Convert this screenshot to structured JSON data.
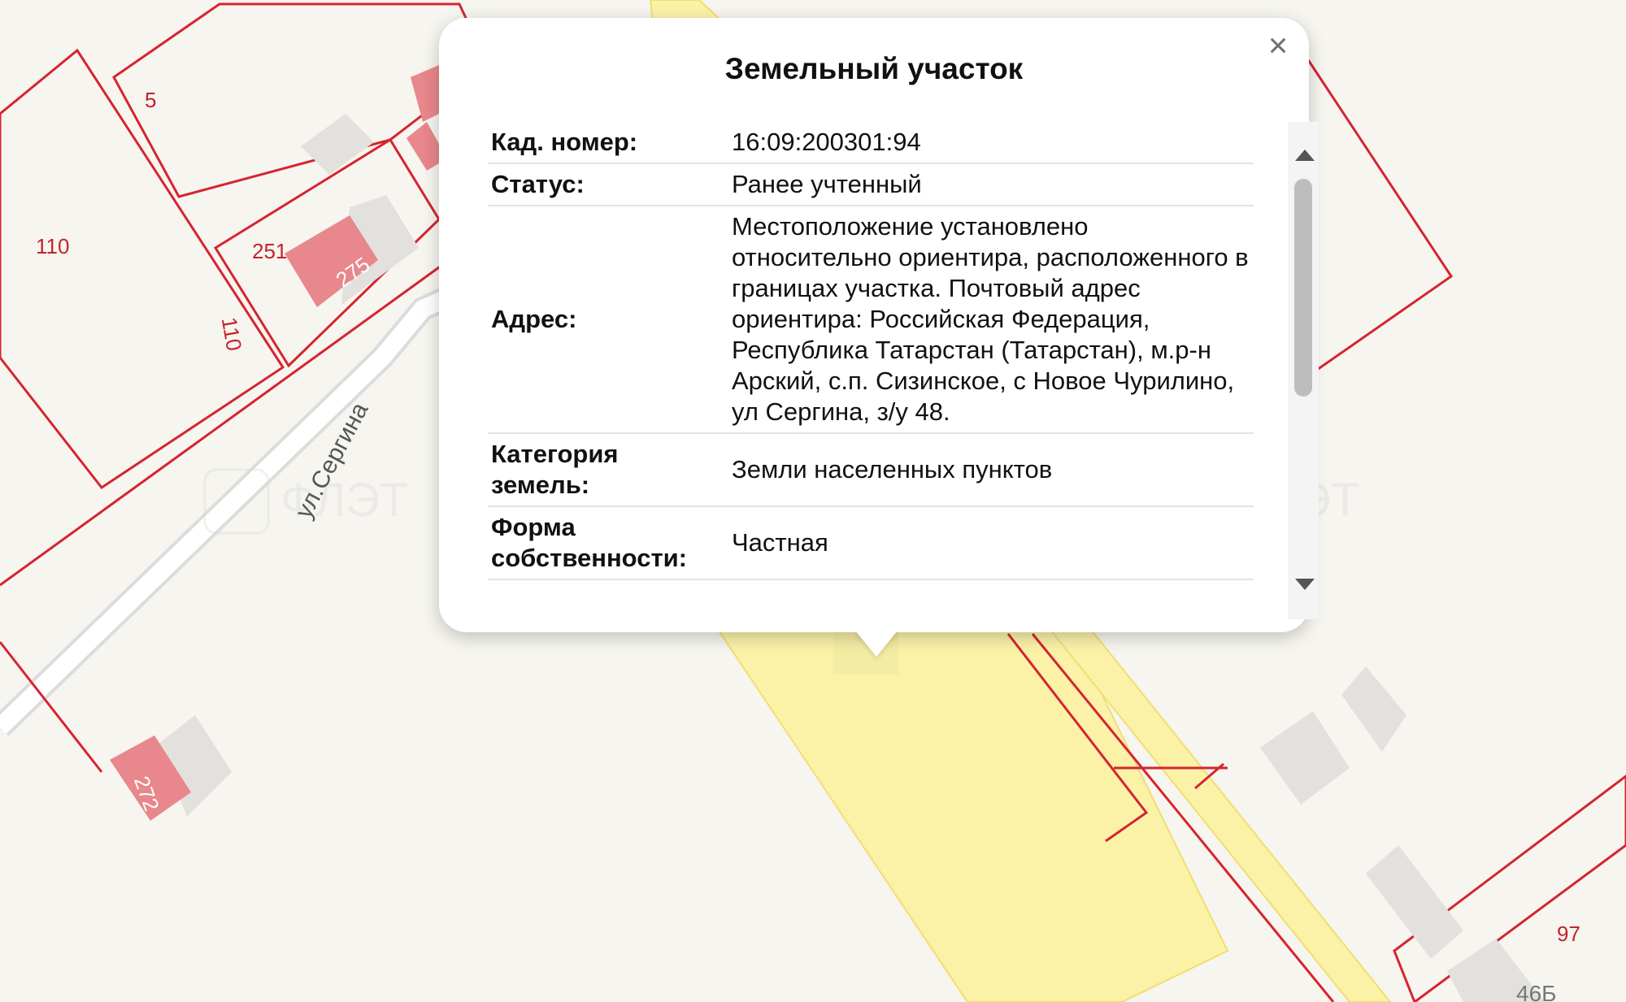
{
  "map": {
    "street_label": "ул.Сергина",
    "parcel_numbers": [
      "5",
      "110",
      "110",
      "251",
      "275",
      "272",
      "97",
      "46Б"
    ],
    "watermark_text": "ФЛЭТ"
  },
  "popup": {
    "title": "Земельный участок",
    "close_symbol": "×",
    "rows": [
      {
        "key": "Кад. номер:",
        "value": "16:09:200301:94"
      },
      {
        "key": "Статус:",
        "value": "Ранее учтенный"
      },
      {
        "key": "Адрес:",
        "value": "Местоположение установлено относительно ориентира, расположенного в границах участка. Почтовый адрес ориентира: Российская Федерация, Республика Татарстан (Татарстан), м.р-н Арский, с.п. Сизинское, с Новое Чурилино, ул Сергина, з/у 48."
      },
      {
        "key": "Категория земель:",
        "value": "Земли населенных пунктов"
      },
      {
        "key": "Форма собственности:",
        "value": "Частная"
      }
    ]
  },
  "colors": {
    "parcel_border": "#d6242f",
    "building_highlight": "#e8878c",
    "building": "#e2e1dd",
    "road_yellow": "#fbf2a8",
    "map_background": "#f6f5ef"
  }
}
